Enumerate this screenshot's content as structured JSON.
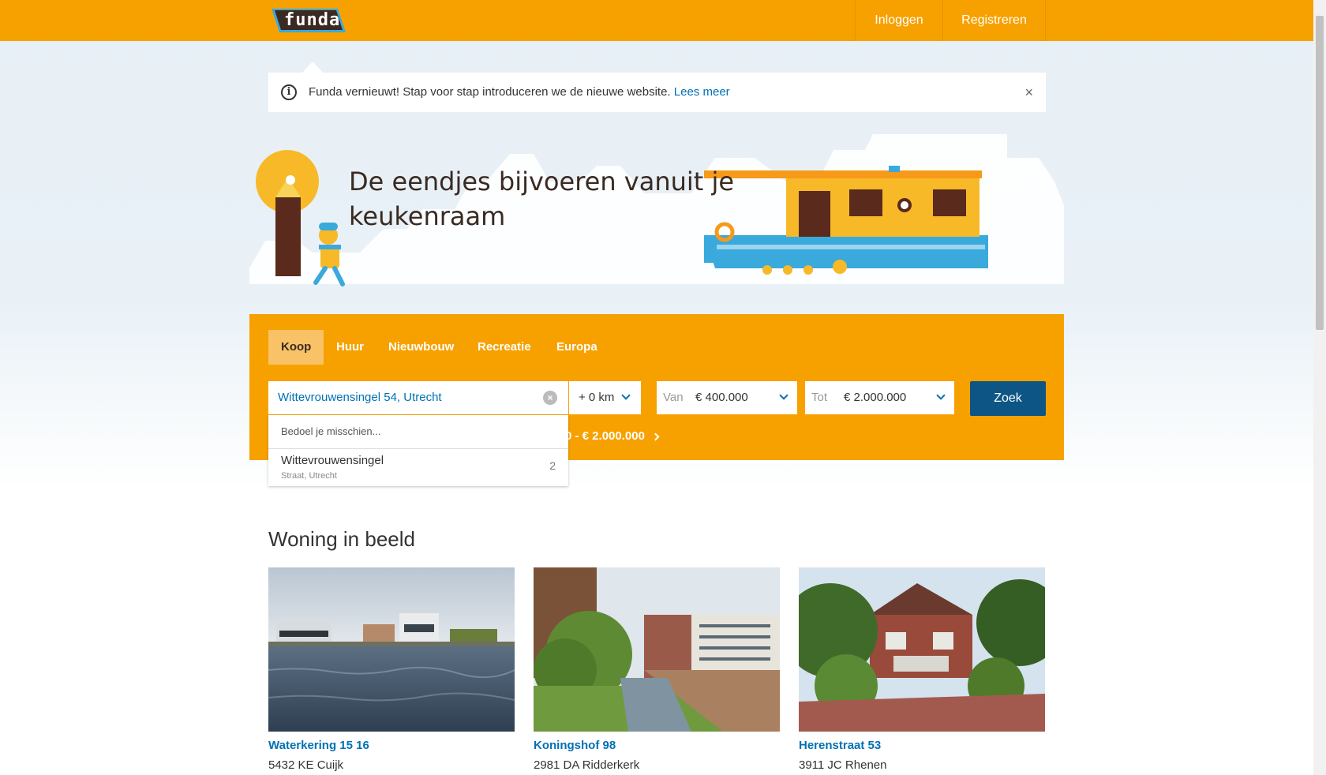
{
  "header": {
    "logo_text": "funda",
    "login_label": "Inloggen",
    "register_label": "Registreren"
  },
  "notice": {
    "text": "Funda vernieuwt! Stap voor stap introduceren we de nieuwe website.",
    "link": "Lees meer",
    "close": "×"
  },
  "hero": {
    "title": "De eendjes bijvoeren vanuit je keukenraam"
  },
  "search": {
    "tabs": [
      "Koop",
      "Huur",
      "Nieuwbouw",
      "Recreatie",
      "Europa"
    ],
    "active_tab": "Koop",
    "location_value": "Wittevrouwensingel 54, Utrecht",
    "radius_value": "+ 0 km",
    "price_from_label": "Van",
    "price_from_value": "€ 400.000",
    "price_to_label": "Tot",
    "price_to_value": "€ 2.000.000",
    "submit_label": "Zoek",
    "saved_search_text": "0 - € 2.000.000"
  },
  "dropdown": {
    "hint": "Bedoel je misschien...",
    "suggestion": "Wittevrouwensingel",
    "suggestion_sub": "Straat, Utrecht",
    "suggestion_count": "2"
  },
  "listings": {
    "title": "Woning in beeld",
    "items": [
      {
        "address": "Waterkering 15 16",
        "zip_city": "5432 KE Cuijk"
      },
      {
        "address": "Koningshof 98",
        "zip_city": "2981 DA Ridderkerk"
      },
      {
        "address": "Herenstraat 53",
        "zip_city": "3911 JC Rhenen"
      }
    ]
  },
  "colors": {
    "brand_orange": "#f7a100",
    "link_blue": "#0071b3",
    "button_blue": "#0d5584"
  }
}
